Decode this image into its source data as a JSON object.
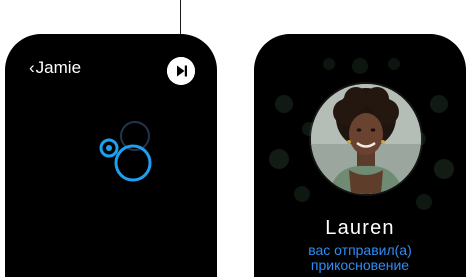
{
  "left_screen": {
    "back_label": "Jamie",
    "back_chevron": "‹",
    "icons": {
      "play": "play-skip-icon",
      "tap": "digital-touch-tap-icon"
    }
  },
  "right_screen": {
    "sender_name": "Lauren",
    "message_line1": "вас отправил(а)",
    "message_line2": "прикосновение",
    "icons": {
      "avatar": "contact-photo"
    }
  },
  "colors": {
    "screen_background": "#000000",
    "accent_blue": "#1ea0f0",
    "message_blue": "#2f8cf2",
    "text_white": "#ffffff"
  }
}
